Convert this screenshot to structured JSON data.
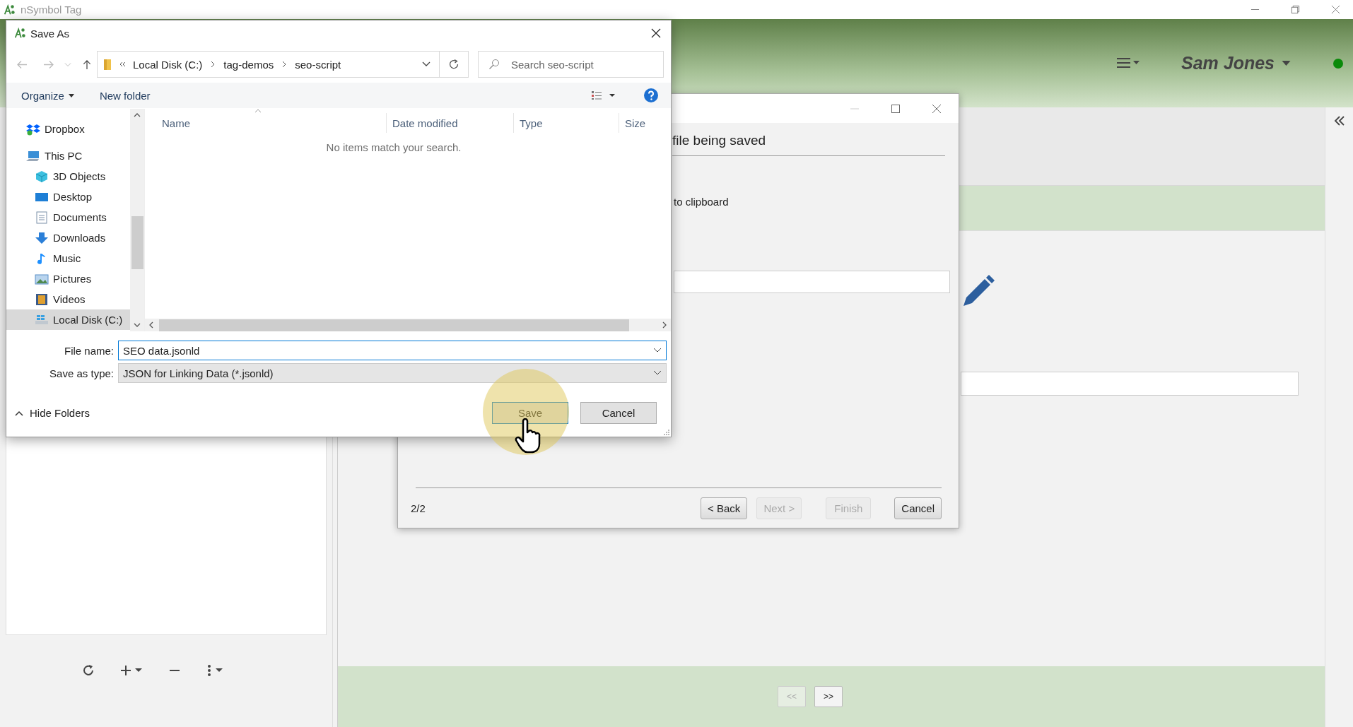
{
  "app": {
    "title": "nSymbol Tag",
    "user_name": "Sam Jones"
  },
  "footer_nav": [
    {
      "label": "<<",
      "disabled": true
    },
    {
      "label": ">>",
      "disabled": false
    }
  ],
  "wizard": {
    "heading": "file being saved",
    "clipboard_text": "to clipboard",
    "page": "2/2",
    "buttons": [
      {
        "label": "< Back",
        "disabled": false
      },
      {
        "label": "Next >",
        "disabled": true
      },
      {
        "label": "Finish",
        "disabled": true
      },
      {
        "label": "Cancel",
        "disabled": false
      }
    ]
  },
  "save_dialog": {
    "title": "Save As",
    "breadcrumb": [
      "Local Disk (C:)",
      "tag-demos",
      "seo-script"
    ],
    "search": {
      "placeholder": "Search seo-script"
    },
    "toolbar": {
      "organize": "Organize",
      "new_folder": "New folder"
    },
    "nav": [
      {
        "label": "Dropbox",
        "kind": "dropbox",
        "selected": false
      },
      {
        "label": "This PC",
        "kind": "pc",
        "selected": false,
        "children": [
          {
            "label": "3D Objects",
            "kind": "objects",
            "selected": false
          },
          {
            "label": "Desktop",
            "kind": "desktop",
            "selected": false
          },
          {
            "label": "Documents",
            "kind": "documents",
            "selected": false
          },
          {
            "label": "Downloads",
            "kind": "downloads",
            "selected": false
          },
          {
            "label": "Music",
            "kind": "music",
            "selected": false
          },
          {
            "label": "Pictures",
            "kind": "pictures",
            "selected": false
          },
          {
            "label": "Videos",
            "kind": "videos",
            "selected": false
          },
          {
            "label": "Local Disk (C:)",
            "kind": "drive",
            "selected": true
          }
        ]
      }
    ],
    "columns": [
      "Name",
      "Date modified",
      "Type",
      "Size"
    ],
    "empty_message": "No items match your search.",
    "file_name": {
      "label": "File name:",
      "value": "SEO data.jsonld"
    },
    "save_type": {
      "label": "Save as type:",
      "value": "JSON for Linking Data (*.jsonld)"
    },
    "hide_folders": "Hide Folders",
    "buttons": [
      {
        "label": "Save",
        "kind": "primary"
      },
      {
        "label": "Cancel",
        "kind": "secondary"
      }
    ]
  }
}
